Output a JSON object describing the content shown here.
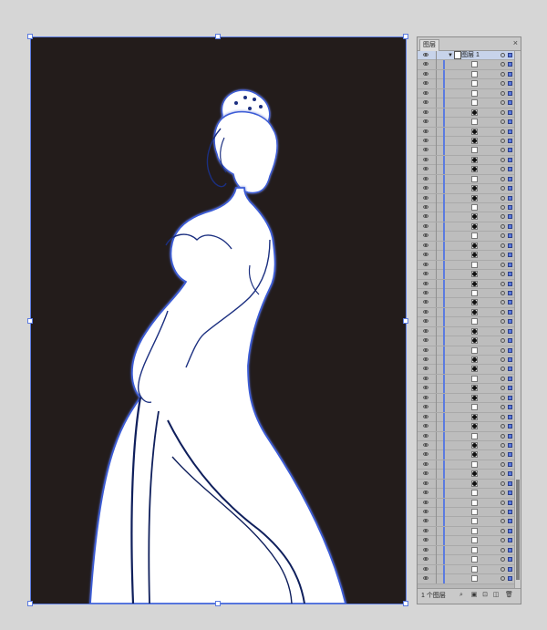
{
  "layers_panel": {
    "tab_label": "图层",
    "close_symbol": "×",
    "menu_symbol": "≡",
    "top_layer_name": "图层 1",
    "footer_count_text": "1 个图层",
    "footer_icons": [
      "search-icon",
      "clip-mask-icon",
      "new-sublayer-icon",
      "new-layer-icon",
      "delete-icon"
    ]
  },
  "colors": {
    "canvas_bg": "#d6d6d6",
    "artboard_bg": "#231c1b",
    "selection_blue": "#5b7be0"
  }
}
